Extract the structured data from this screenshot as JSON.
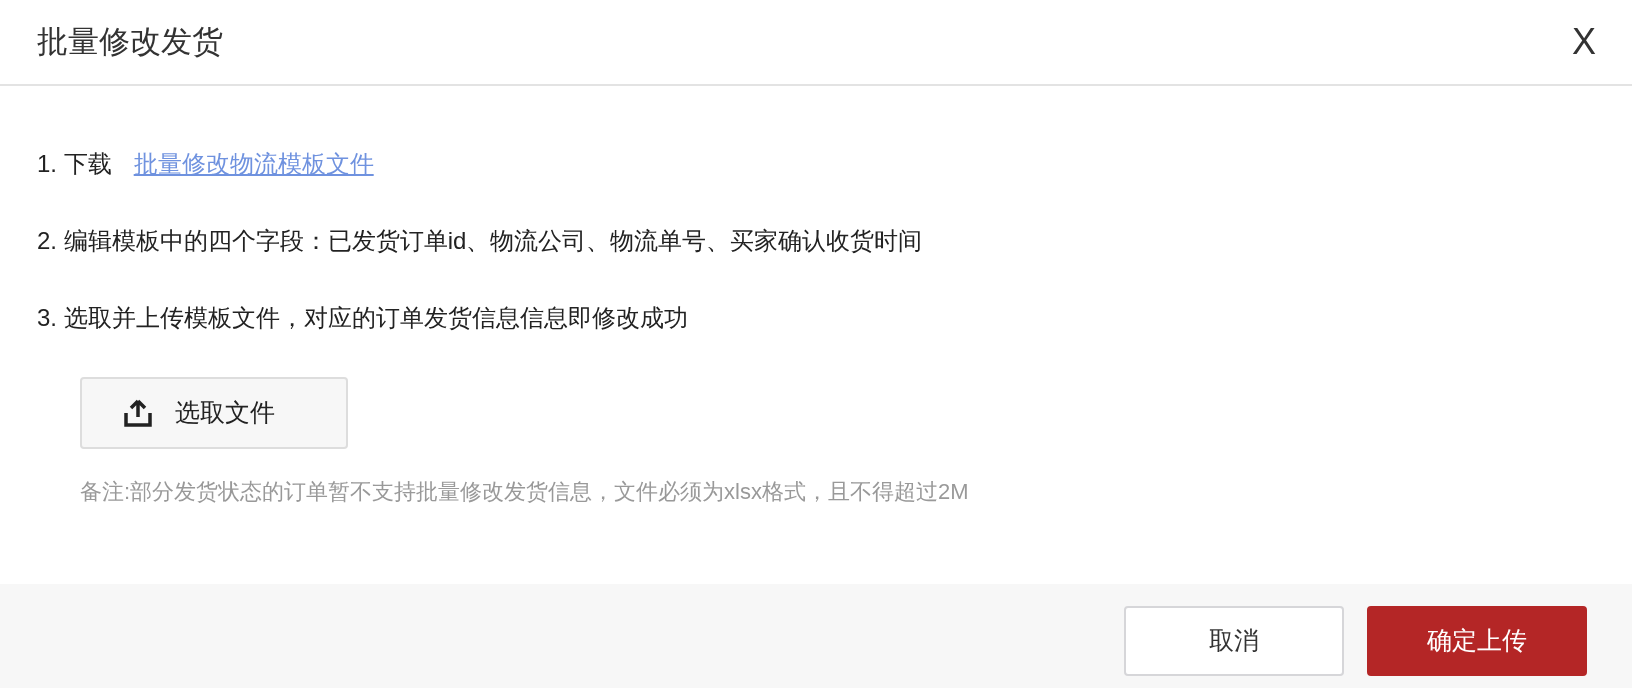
{
  "dialog": {
    "title": "批量修改发货",
    "close": "X"
  },
  "steps": [
    {
      "text": "1. 下载",
      "link": "批量修改物流模板文件"
    },
    {
      "text": "2. 编辑模板中的四个字段：已发货订单id、物流公司、物流单号、买家确认收货时间"
    },
    {
      "text": "3. 选取并上传模板文件，对应的订单发货信息信息即修改成功"
    }
  ],
  "upload_button": "选取文件",
  "note": "备注:部分发货状态的订单暂不支持批量修改发货信息，文件必须为xlsx格式，且不得超过2M",
  "buttons": [
    {
      "label": "取消",
      "kind": "secondary"
    },
    {
      "label": "确定上传",
      "kind": "primary"
    }
  ]
}
